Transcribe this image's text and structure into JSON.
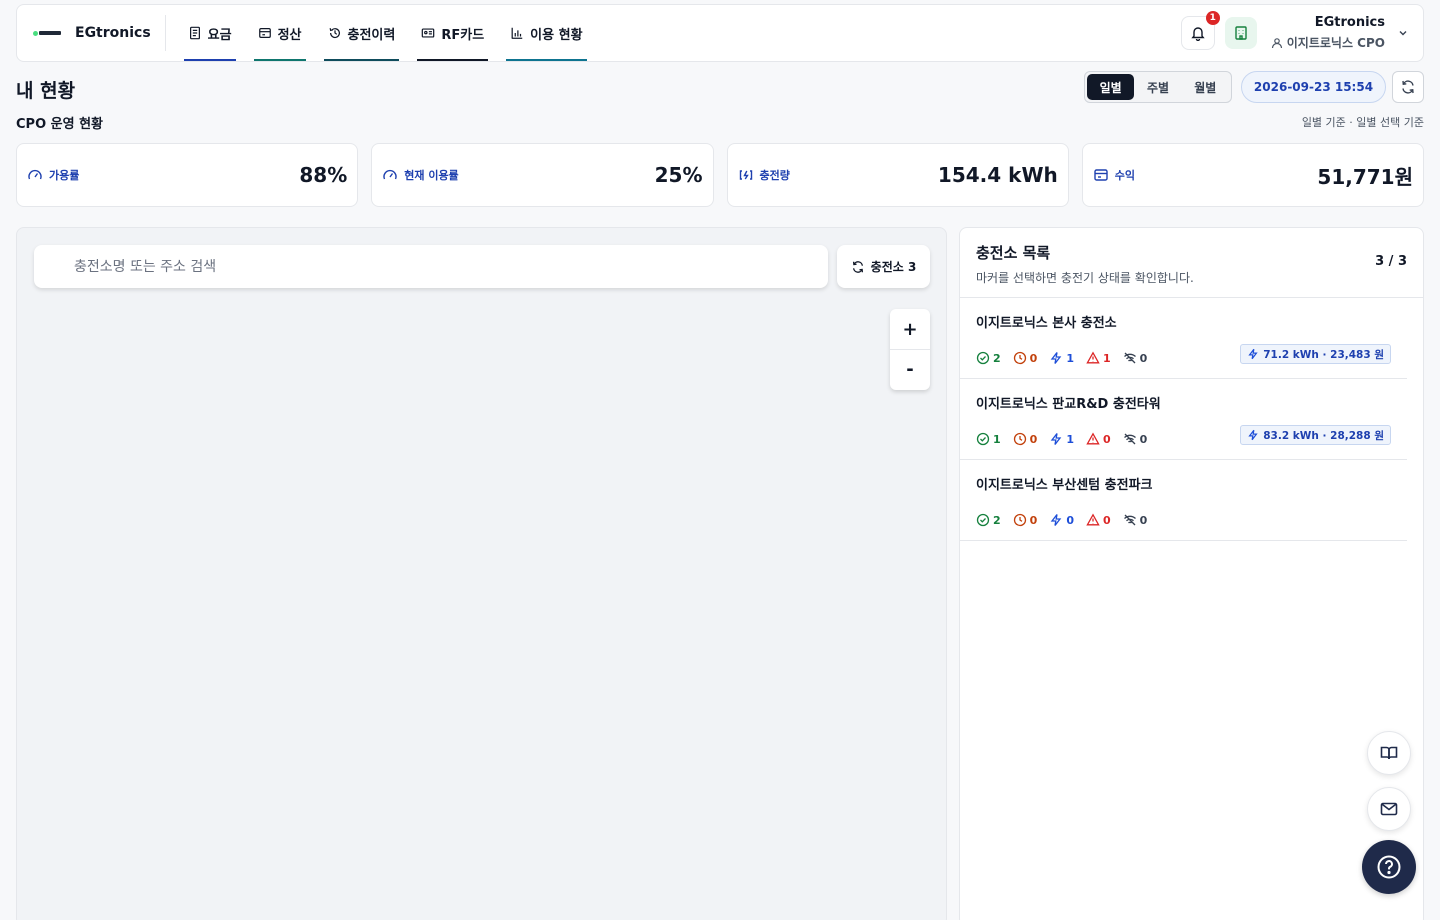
{
  "brand": {
    "name": "EGtronics"
  },
  "nav": [
    {
      "label": "요금",
      "icon": "document-icon",
      "underline": "#1e40af"
    },
    {
      "label": "정산",
      "icon": "wallet-icon",
      "underline": "#0f766e"
    },
    {
      "label": "충전이력",
      "icon": "history-icon",
      "underline": "#0f4c5c"
    },
    {
      "label": "RF카드",
      "icon": "id-card-icon",
      "underline": "#111827"
    },
    {
      "label": "이용 현황",
      "icon": "bar-chart-icon",
      "underline": "#0e7490"
    }
  ],
  "header": {
    "notification_count": "1",
    "user_name": "EGtronics",
    "user_role": "이지트로닉스 CPO"
  },
  "page": {
    "title": "내 현황",
    "section_title": "CPO 운영 현황",
    "periods": [
      "일별",
      "주별",
      "월별"
    ],
    "active_period": "일별",
    "datetime": "2026-09-23 15:54",
    "basis": "일별 기준 · 일별 선택 기준"
  },
  "stats": [
    {
      "label": "가용률",
      "value": "88%",
      "icon": "gauge-icon"
    },
    {
      "label": "현재 이용률",
      "value": "25%",
      "icon": "gauge-icon"
    },
    {
      "label": "충전량",
      "value": "154.4 kWh",
      "icon": "charging-icon"
    },
    {
      "label": "수익",
      "value": "51,771원",
      "icon": "wallet-icon"
    }
  ],
  "map": {
    "search_placeholder": "충전소명 또는 주소 검색",
    "station_button": "충전소 3",
    "zoom_in": "+",
    "zoom_out": "-"
  },
  "station_list": {
    "title": "충전소 목록",
    "subtitle": "마커를 선택하면 충전기 상태를 확인합니다.",
    "count": "3 / 3",
    "stations": [
      {
        "name": "이지트로닉스 본사 충전소",
        "available": "2",
        "waiting": "0",
        "charging": "1",
        "fault": "1",
        "offline": "0",
        "energy": "71.2 kWh · 23,483 원"
      },
      {
        "name": "이지트로닉스 판교R&D 충전타워",
        "available": "1",
        "waiting": "0",
        "charging": "1",
        "fault": "0",
        "offline": "0",
        "energy": "83.2 kWh · 28,288 원"
      },
      {
        "name": "이지트로닉스 부산센텀 충전파크",
        "available": "2",
        "waiting": "0",
        "charging": "0",
        "fault": "0",
        "offline": "0",
        "energy": ""
      }
    ]
  },
  "colors": {
    "available": "#15803d",
    "waiting": "#c2410c",
    "charging": "#1d4ed8",
    "fault": "#dc2626",
    "offline": "#374151",
    "accent": "#1e40af"
  }
}
